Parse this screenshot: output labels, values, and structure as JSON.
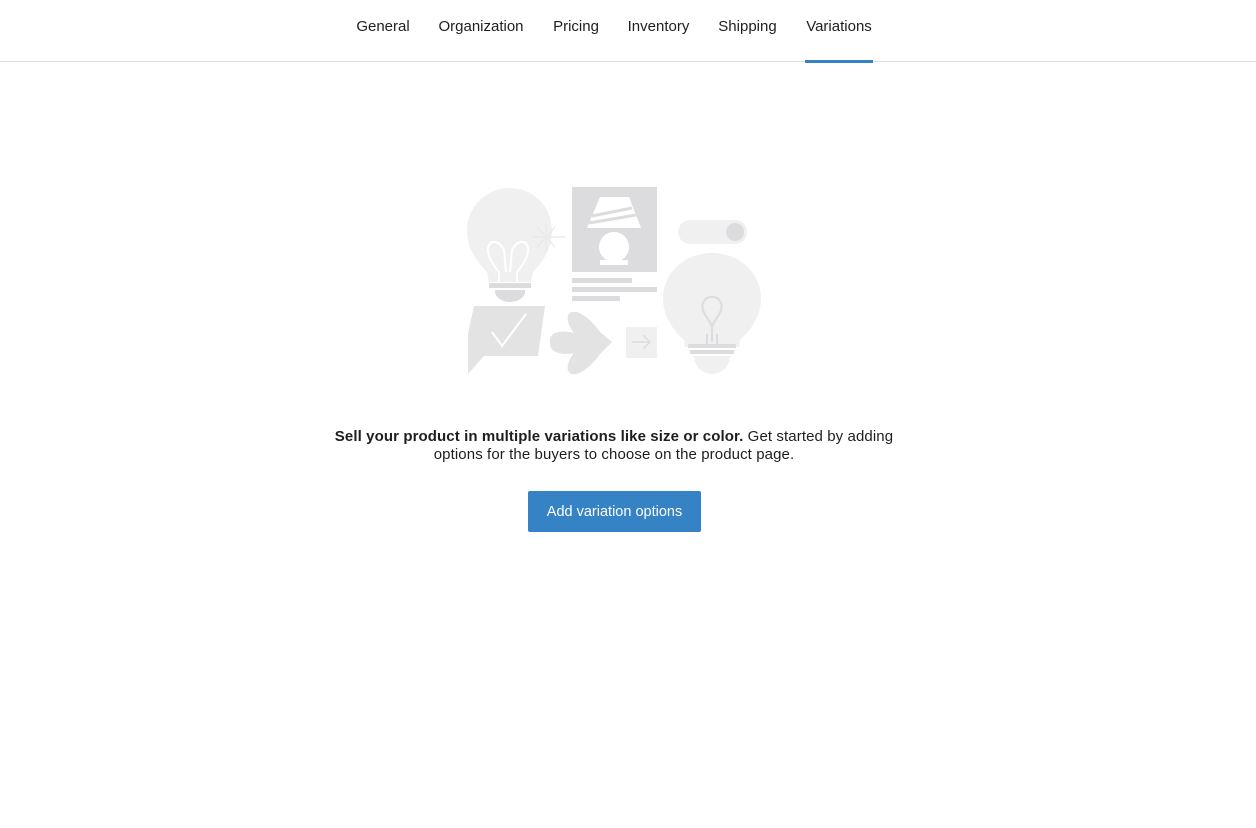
{
  "tabs": [
    {
      "label": "General"
    },
    {
      "label": "Organization"
    },
    {
      "label": "Pricing"
    },
    {
      "label": "Inventory"
    },
    {
      "label": "Shipping"
    },
    {
      "label": "Variations",
      "active": true
    }
  ],
  "empty_state": {
    "message_bold": "Sell your product in multiple variations like size or color.",
    "message_rest": " Get started by adding options for the buyers to choose on the product page.",
    "button_label": "Add variation options",
    "illustration_icons": [
      "lightbulb-icon",
      "lamp-card-icon",
      "toggle-icon",
      "lightbulb-outline-icon",
      "speech-check-icon",
      "flower-arrow-icon",
      "arrow-right-icon"
    ]
  },
  "colors": {
    "accent": "#3582c4",
    "illustration_fill": "#f0f0f0",
    "illustration_mid": "#dcdcde",
    "text": "#1e1e1e"
  }
}
